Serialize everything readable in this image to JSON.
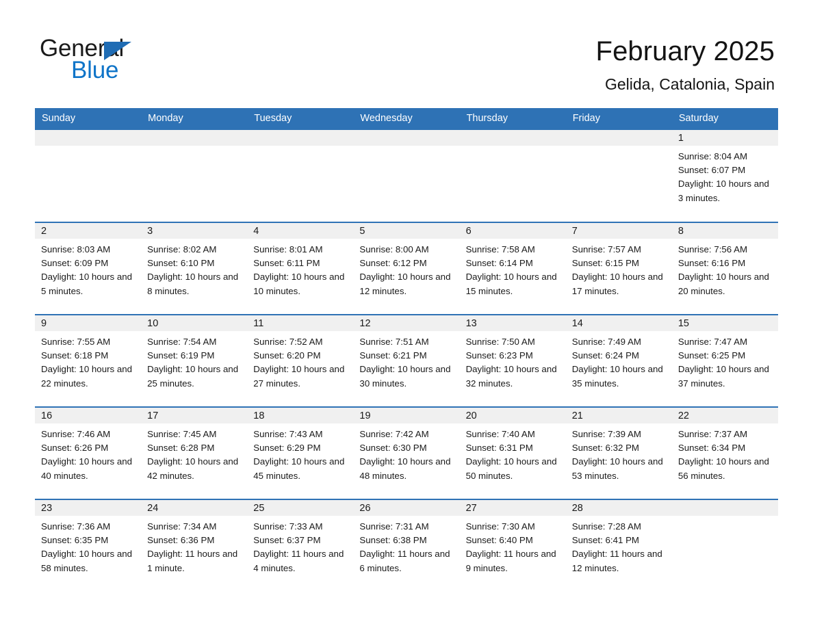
{
  "brand": {
    "name_part1": "General",
    "name_part2": "Blue",
    "triangle_icon": "triangle-icon",
    "accent_color": "#1f6cb4",
    "blue_text_color": "#0f74c8"
  },
  "header": {
    "title": "February 2025",
    "subtitle": "Gelida, Catalonia, Spain"
  },
  "calendar": {
    "header_bg": "#2e72b5",
    "daynum_bg": "#f0f0f0",
    "weekdays": [
      "Sunday",
      "Monday",
      "Tuesday",
      "Wednesday",
      "Thursday",
      "Friday",
      "Saturday"
    ],
    "weeks": [
      [
        {
          "day": "",
          "blank": true,
          "sunrise": "",
          "sunset": "",
          "daylight": ""
        },
        {
          "day": "",
          "blank": true,
          "sunrise": "",
          "sunset": "",
          "daylight": ""
        },
        {
          "day": "",
          "blank": true,
          "sunrise": "",
          "sunset": "",
          "daylight": ""
        },
        {
          "day": "",
          "blank": true,
          "sunrise": "",
          "sunset": "",
          "daylight": ""
        },
        {
          "day": "",
          "blank": true,
          "sunrise": "",
          "sunset": "",
          "daylight": ""
        },
        {
          "day": "",
          "blank": true,
          "sunrise": "",
          "sunset": "",
          "daylight": ""
        },
        {
          "day": "1",
          "blank": false,
          "sunrise": "Sunrise: 8:04 AM",
          "sunset": "Sunset: 6:07 PM",
          "daylight": "Daylight: 10 hours and 3 minutes."
        }
      ],
      [
        {
          "day": "2",
          "blank": false,
          "sunrise": "Sunrise: 8:03 AM",
          "sunset": "Sunset: 6:09 PM",
          "daylight": "Daylight: 10 hours and 5 minutes."
        },
        {
          "day": "3",
          "blank": false,
          "sunrise": "Sunrise: 8:02 AM",
          "sunset": "Sunset: 6:10 PM",
          "daylight": "Daylight: 10 hours and 8 minutes."
        },
        {
          "day": "4",
          "blank": false,
          "sunrise": "Sunrise: 8:01 AM",
          "sunset": "Sunset: 6:11 PM",
          "daylight": "Daylight: 10 hours and 10 minutes."
        },
        {
          "day": "5",
          "blank": false,
          "sunrise": "Sunrise: 8:00 AM",
          "sunset": "Sunset: 6:12 PM",
          "daylight": "Daylight: 10 hours and 12 minutes."
        },
        {
          "day": "6",
          "blank": false,
          "sunrise": "Sunrise: 7:58 AM",
          "sunset": "Sunset: 6:14 PM",
          "daylight": "Daylight: 10 hours and 15 minutes."
        },
        {
          "day": "7",
          "blank": false,
          "sunrise": "Sunrise: 7:57 AM",
          "sunset": "Sunset: 6:15 PM",
          "daylight": "Daylight: 10 hours and 17 minutes."
        },
        {
          "day": "8",
          "blank": false,
          "sunrise": "Sunrise: 7:56 AM",
          "sunset": "Sunset: 6:16 PM",
          "daylight": "Daylight: 10 hours and 20 minutes."
        }
      ],
      [
        {
          "day": "9",
          "blank": false,
          "sunrise": "Sunrise: 7:55 AM",
          "sunset": "Sunset: 6:18 PM",
          "daylight": "Daylight: 10 hours and 22 minutes."
        },
        {
          "day": "10",
          "blank": false,
          "sunrise": "Sunrise: 7:54 AM",
          "sunset": "Sunset: 6:19 PM",
          "daylight": "Daylight: 10 hours and 25 minutes."
        },
        {
          "day": "11",
          "blank": false,
          "sunrise": "Sunrise: 7:52 AM",
          "sunset": "Sunset: 6:20 PM",
          "daylight": "Daylight: 10 hours and 27 minutes."
        },
        {
          "day": "12",
          "blank": false,
          "sunrise": "Sunrise: 7:51 AM",
          "sunset": "Sunset: 6:21 PM",
          "daylight": "Daylight: 10 hours and 30 minutes."
        },
        {
          "day": "13",
          "blank": false,
          "sunrise": "Sunrise: 7:50 AM",
          "sunset": "Sunset: 6:23 PM",
          "daylight": "Daylight: 10 hours and 32 minutes."
        },
        {
          "day": "14",
          "blank": false,
          "sunrise": "Sunrise: 7:49 AM",
          "sunset": "Sunset: 6:24 PM",
          "daylight": "Daylight: 10 hours and 35 minutes."
        },
        {
          "day": "15",
          "blank": false,
          "sunrise": "Sunrise: 7:47 AM",
          "sunset": "Sunset: 6:25 PM",
          "daylight": "Daylight: 10 hours and 37 minutes."
        }
      ],
      [
        {
          "day": "16",
          "blank": false,
          "sunrise": "Sunrise: 7:46 AM",
          "sunset": "Sunset: 6:26 PM",
          "daylight": "Daylight: 10 hours and 40 minutes."
        },
        {
          "day": "17",
          "blank": false,
          "sunrise": "Sunrise: 7:45 AM",
          "sunset": "Sunset: 6:28 PM",
          "daylight": "Daylight: 10 hours and 42 minutes."
        },
        {
          "day": "18",
          "blank": false,
          "sunrise": "Sunrise: 7:43 AM",
          "sunset": "Sunset: 6:29 PM",
          "daylight": "Daylight: 10 hours and 45 minutes."
        },
        {
          "day": "19",
          "blank": false,
          "sunrise": "Sunrise: 7:42 AM",
          "sunset": "Sunset: 6:30 PM",
          "daylight": "Daylight: 10 hours and 48 minutes."
        },
        {
          "day": "20",
          "blank": false,
          "sunrise": "Sunrise: 7:40 AM",
          "sunset": "Sunset: 6:31 PM",
          "daylight": "Daylight: 10 hours and 50 minutes."
        },
        {
          "day": "21",
          "blank": false,
          "sunrise": "Sunrise: 7:39 AM",
          "sunset": "Sunset: 6:32 PM",
          "daylight": "Daylight: 10 hours and 53 minutes."
        },
        {
          "day": "22",
          "blank": false,
          "sunrise": "Sunrise: 7:37 AM",
          "sunset": "Sunset: 6:34 PM",
          "daylight": "Daylight: 10 hours and 56 minutes."
        }
      ],
      [
        {
          "day": "23",
          "blank": false,
          "sunrise": "Sunrise: 7:36 AM",
          "sunset": "Sunset: 6:35 PM",
          "daylight": "Daylight: 10 hours and 58 minutes."
        },
        {
          "day": "24",
          "blank": false,
          "sunrise": "Sunrise: 7:34 AM",
          "sunset": "Sunset: 6:36 PM",
          "daylight": "Daylight: 11 hours and 1 minute."
        },
        {
          "day": "25",
          "blank": false,
          "sunrise": "Sunrise: 7:33 AM",
          "sunset": "Sunset: 6:37 PM",
          "daylight": "Daylight: 11 hours and 4 minutes."
        },
        {
          "day": "26",
          "blank": false,
          "sunrise": "Sunrise: 7:31 AM",
          "sunset": "Sunset: 6:38 PM",
          "daylight": "Daylight: 11 hours and 6 minutes."
        },
        {
          "day": "27",
          "blank": false,
          "sunrise": "Sunrise: 7:30 AM",
          "sunset": "Sunset: 6:40 PM",
          "daylight": "Daylight: 11 hours and 9 minutes."
        },
        {
          "day": "28",
          "blank": false,
          "sunrise": "Sunrise: 7:28 AM",
          "sunset": "Sunset: 6:41 PM",
          "daylight": "Daylight: 11 hours and 12 minutes."
        },
        {
          "day": "",
          "blank": true,
          "sunrise": "",
          "sunset": "",
          "daylight": ""
        }
      ]
    ]
  }
}
